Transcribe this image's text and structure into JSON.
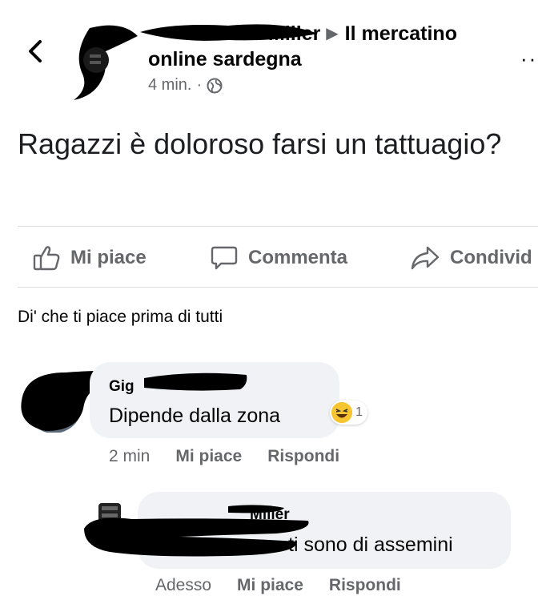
{
  "header": {
    "back_icon": "chevron-left-icon",
    "author_name": "Miller",
    "group_name_line1": "Il mercatino",
    "group_name_line2": "online sardegna",
    "timestamp": "4 min.",
    "separator": "·",
    "privacy_icon": "globe-icon",
    "more_label": "··"
  },
  "post": {
    "text": "Ragazzi è doloroso farsi un tattuagio?"
  },
  "actions": {
    "like_label": "Mi piace",
    "comment_label": "Commenta",
    "share_label": "Condivid"
  },
  "first_like_prompt": "Di' che ti piace prima di tutti",
  "comments": [
    {
      "author": "Gig",
      "text": "Dipende dalla zona",
      "reaction_icon": "laughing-emoji-icon",
      "reaction_count": "1",
      "time": "2 min",
      "like_label": "Mi piace",
      "reply_label": "Rispondi"
    },
    {
      "author": "Miller",
      "text": "ti  sono di assemini",
      "time": "Adesso",
      "like_label": "Mi piace",
      "reply_label": "Rispondi"
    }
  ],
  "colors": {
    "text": "#050505",
    "secondary": "#65676b",
    "bubble": "#f0f2f5",
    "divider": "#dadde1",
    "redaction": "#000000"
  }
}
